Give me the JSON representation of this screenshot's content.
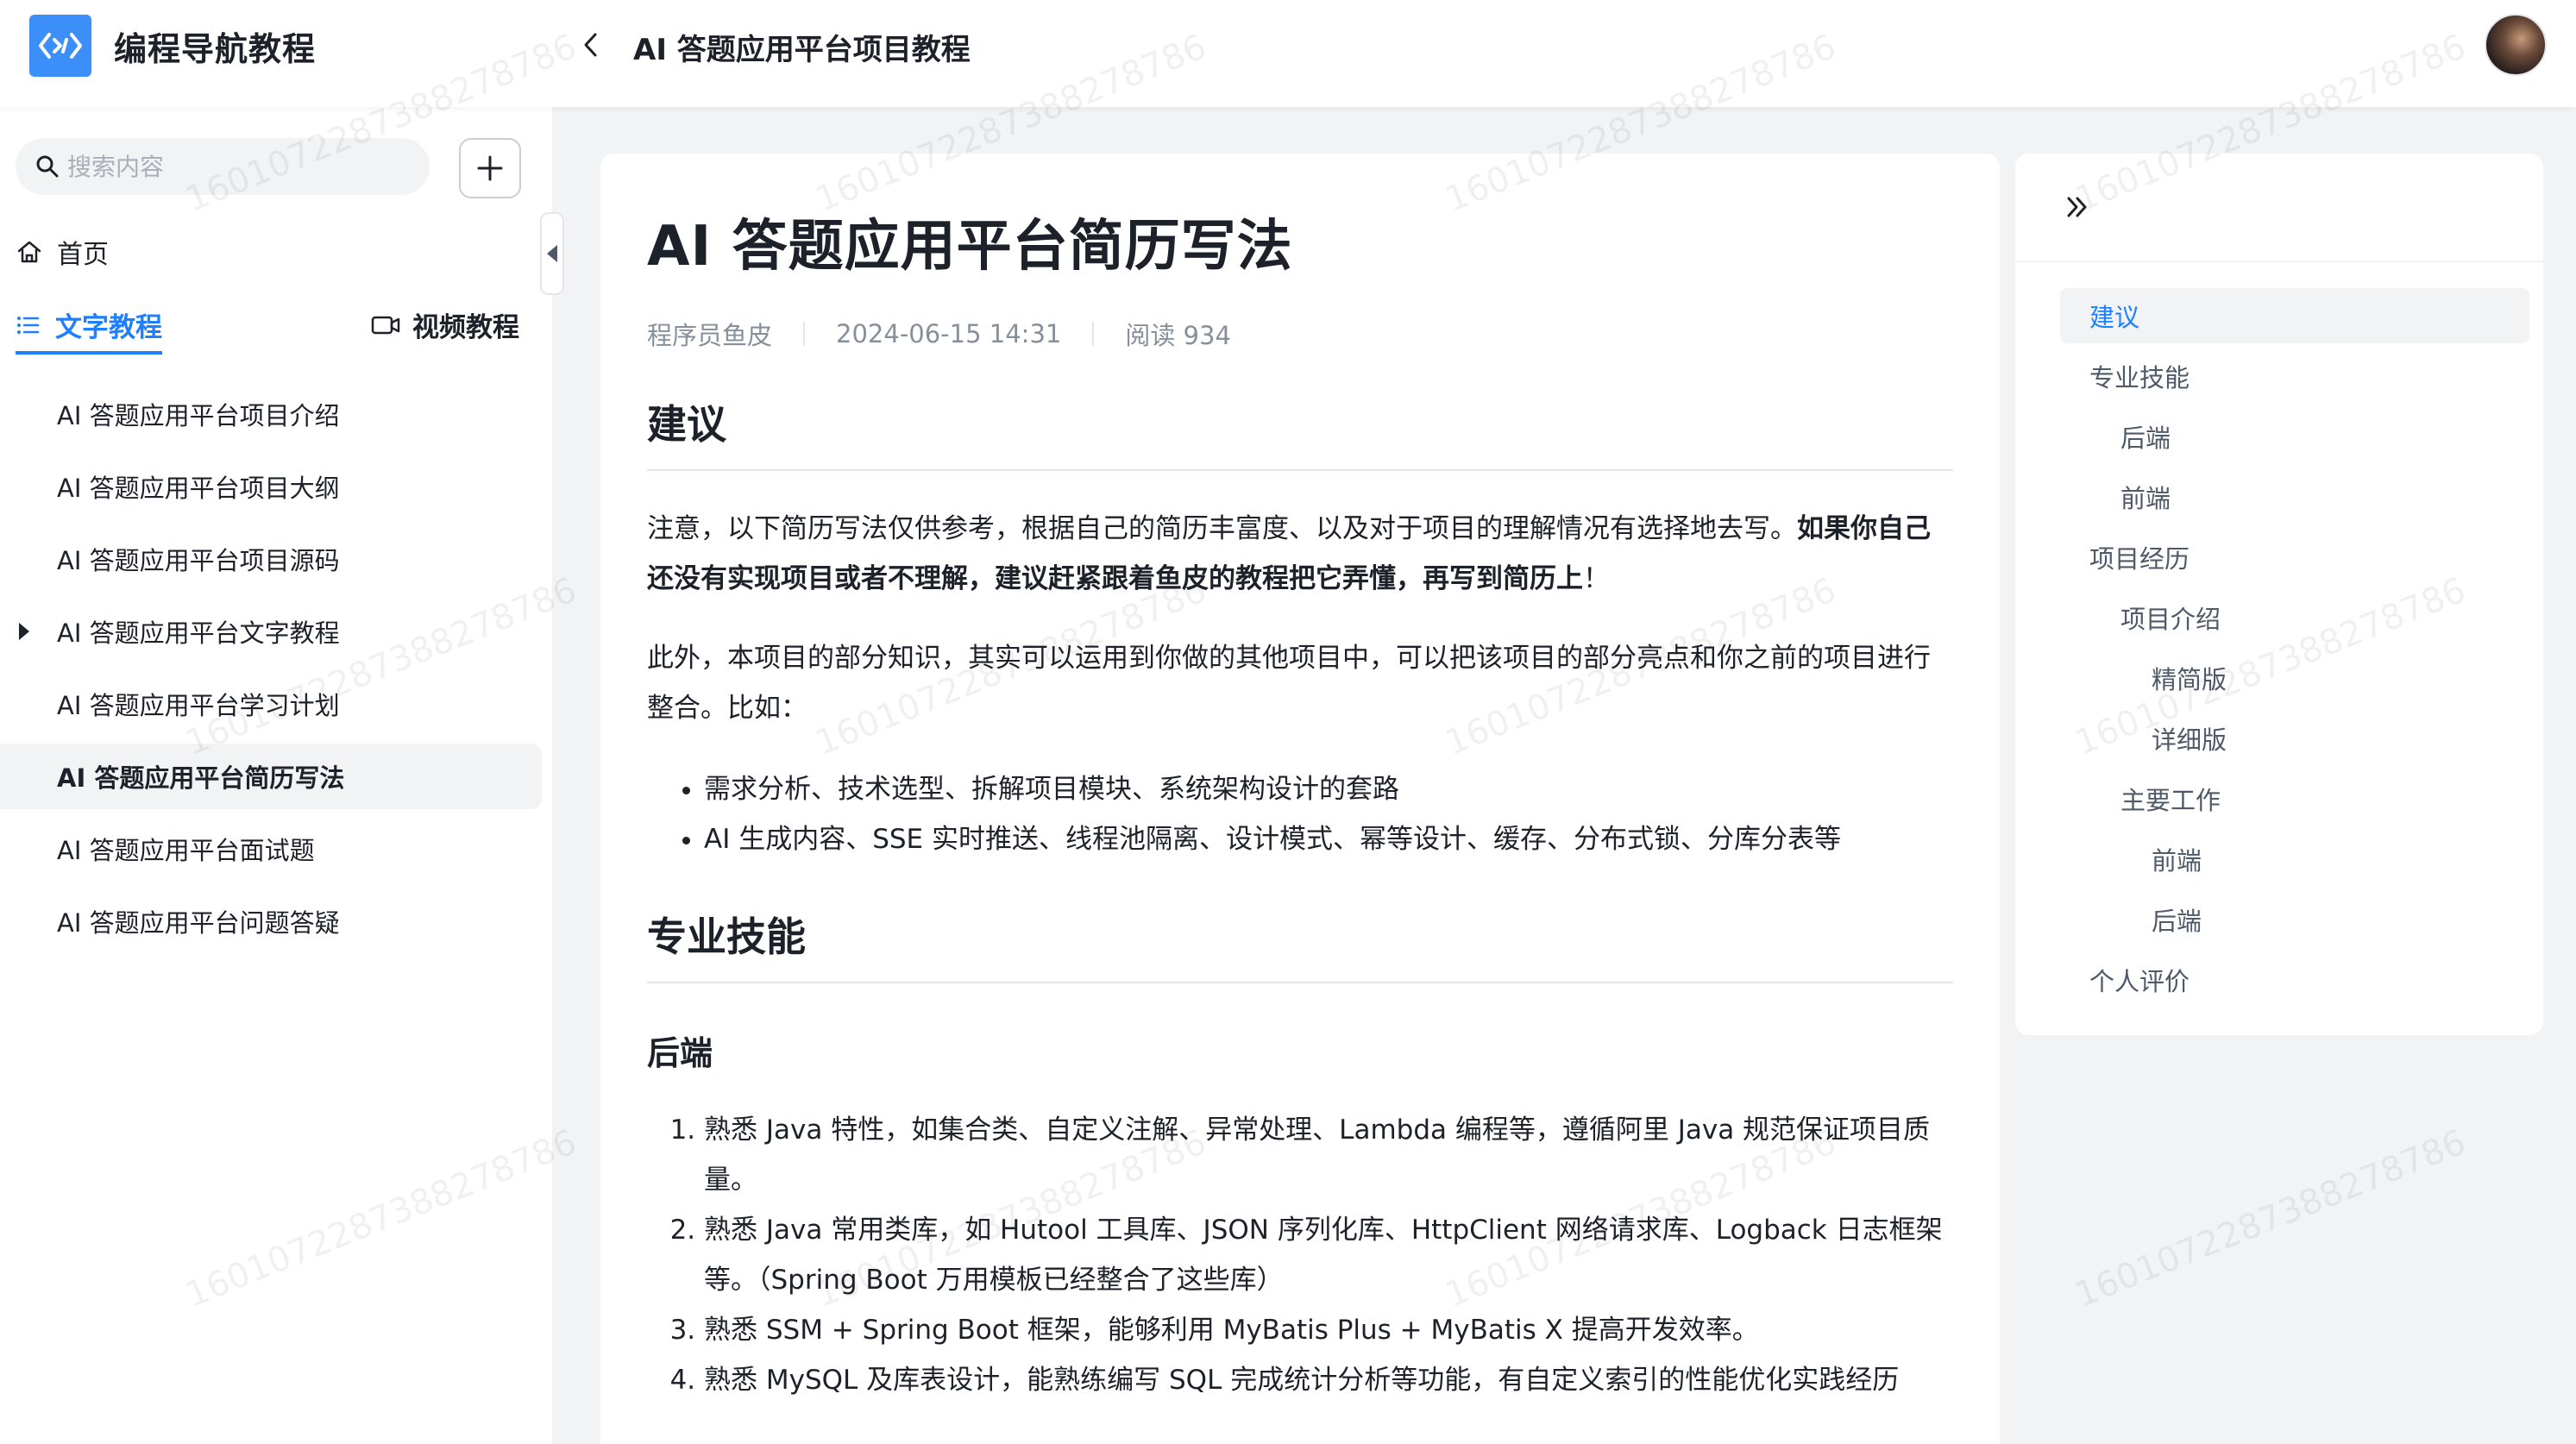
{
  "header": {
    "brand": "编程导航教程",
    "title": "AI 答题应用平台项目教程"
  },
  "sidebar": {
    "search_placeholder": "搜索内容",
    "home_label": "首页",
    "tabs": {
      "text_label": "文字教程",
      "video_label": "视频教程"
    },
    "items": [
      {
        "label": "AI 答题应用平台项目介绍"
      },
      {
        "label": "AI 答题应用平台项目大纲"
      },
      {
        "label": "AI 答题应用平台项目源码"
      },
      {
        "label": "AI 答题应用平台文字教程"
      },
      {
        "label": "AI 答题应用平台学习计划"
      },
      {
        "label": "AI 答题应用平台简历写法"
      },
      {
        "label": "AI 答题应用平台面试题"
      },
      {
        "label": "AI 答题应用平台问题答疑"
      }
    ]
  },
  "article": {
    "title": "AI 答题应用平台简历写法",
    "author": "程序员鱼皮",
    "date": "2024-06-15 14:31",
    "reads": "阅读 934",
    "section_suggest": "建议",
    "p1_normal": "注意，以下简历写法仅供参考，根据自己的简历丰富度、以及对于项目的理解情况有选择地去写。",
    "p1_bold": "如果你自己还没有实现项目或者不理解，建议赶紧跟着鱼皮的教程把它弄懂，再写到简历上",
    "p1_end": "！",
    "p2": "此外，本项目的部分知识，其实可以运用到你做的其他项目中，可以把该项目的部分亮点和你之前的项目进行整合。比如：",
    "bullets": [
      "需求分析、技术选型、拆解项目模块、系统架构设计的套路",
      "AI 生成内容、SSE 实时推送、线程池隔离、设计模式、幂等设计、缓存、分布式锁、分库分表等"
    ],
    "section_skill": "专业技能",
    "sub_backend": "后端",
    "skills": [
      "熟悉 Java 特性，如集合类、自定义注解、异常处理、Lambda 编程等，遵循阿里 Java 规范保证项目质量。",
      "熟悉 Java 常用类库，如 Hutool 工具库、JSON 序列化库、HttpClient 网络请求库、Logback 日志框架等。（Spring Boot 万用模板已经整合了这些库）",
      "熟悉 SSM + Spring Boot 框架，能够利用 MyBatis Plus + MyBatis X 提高开发效率。",
      "熟悉 MySQL 及库表设计，能熟练编写 SQL 完成统计分析等功能，有自定义索引的性能优化实践经历"
    ]
  },
  "toc": {
    "items": [
      {
        "label": "建议"
      },
      {
        "label": "专业技能"
      },
      {
        "label": "后端"
      },
      {
        "label": "前端"
      },
      {
        "label": "项目经历"
      },
      {
        "label": "项目介绍"
      },
      {
        "label": "精简版"
      },
      {
        "label": "详细版"
      },
      {
        "label": "主要工作"
      },
      {
        "label": "前端"
      },
      {
        "label": "后端"
      },
      {
        "label": "个人评价"
      }
    ]
  },
  "watermark": "16010722873882787​86",
  "colors": {
    "accent": "#1e80ff",
    "logo": "#3c8ff8",
    "background": "#f2f3f5"
  }
}
